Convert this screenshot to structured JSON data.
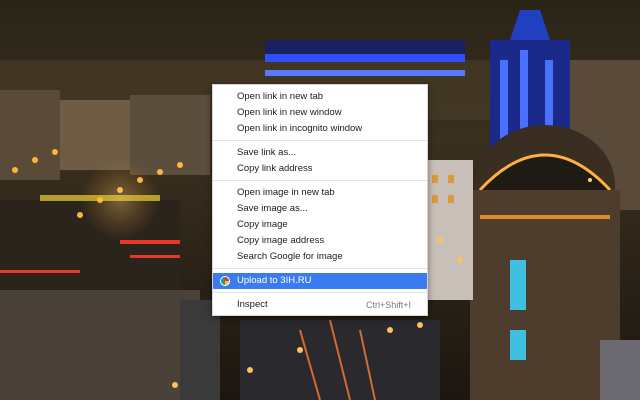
{
  "context_menu": {
    "groups": [
      [
        "Open link in new tab",
        "Open link in new window",
        "Open link in incognito window"
      ],
      [
        "Save link as...",
        "Copy link address"
      ],
      [
        "Open image in new tab",
        "Save image as...",
        "Copy image",
        "Copy image address",
        "Search Google for image"
      ]
    ],
    "extension_item": {
      "label": "Upload to 3IH.RU",
      "icon": "upload-extension-icon",
      "highlighted": true,
      "highlight_color": "#3a7cf0"
    },
    "inspect_item": {
      "label": "Inspect",
      "shortcut": "Ctrl+Shift+I"
    }
  }
}
